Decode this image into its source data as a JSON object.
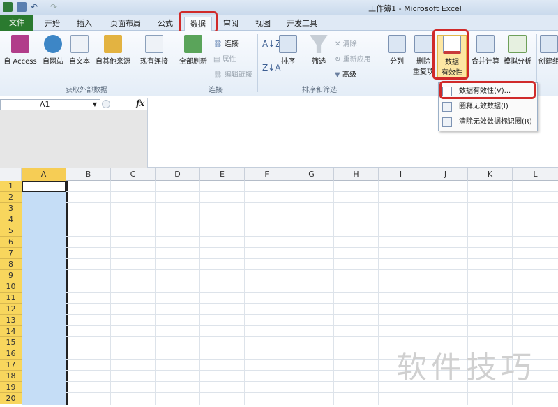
{
  "window": {
    "title": "工作簿1 - Microsoft Excel"
  },
  "tabs": [
    {
      "label": "文件"
    },
    {
      "label": "开始"
    },
    {
      "label": "插入"
    },
    {
      "label": "页面布局"
    },
    {
      "label": "公式"
    },
    {
      "label": "数据"
    },
    {
      "label": "审阅"
    },
    {
      "label": "视图"
    },
    {
      "label": "开发工具"
    }
  ],
  "ribbon": {
    "get_external": {
      "buttons": [
        "自 Access",
        "自网站",
        "自文本",
        "自其他来源",
        "现有连接"
      ],
      "label": "获取外部数据"
    },
    "connections": {
      "refresh_all": "全部刷新",
      "connections": "连接",
      "properties": "属性",
      "edit_links": "编辑链接",
      "label": "连接"
    },
    "sort_filter": {
      "sort": "排序",
      "filter": "筛选",
      "clear": "清除",
      "reapply": "重新应用",
      "advanced": "高级",
      "label": "排序和筛选"
    },
    "data_tools": {
      "text_to_columns": "分列",
      "remove_dup_1": "删除",
      "remove_dup_2": "重复项",
      "validation_1": "数据",
      "validation_2": "有效性",
      "consolidate": "合并计算",
      "what_if": "模拟分析",
      "create": "创建组"
    }
  },
  "formula_bar": {
    "name_box": "A1",
    "fx": "fx"
  },
  "columns": [
    "A",
    "B",
    "C",
    "D",
    "E",
    "F",
    "G",
    "H",
    "I",
    "J",
    "K",
    "L"
  ],
  "rows": [
    "1",
    "2",
    "3",
    "4",
    "5",
    "6",
    "7",
    "8",
    "9",
    "10",
    "11",
    "12",
    "13",
    "14",
    "15",
    "16",
    "17",
    "18",
    "19",
    "20"
  ],
  "dropdown_menu": {
    "items": [
      "数据有效性(V)...",
      "圈释无效数据(I)",
      "清除无效数据标识圈(R)"
    ]
  },
  "watermark": "软件技巧",
  "colors": {
    "file_tab": "#2a7a2f",
    "highlight": "#d02a2a",
    "selected_col": "#c5ddf6",
    "row_header_selected": "#f8d65d"
  }
}
